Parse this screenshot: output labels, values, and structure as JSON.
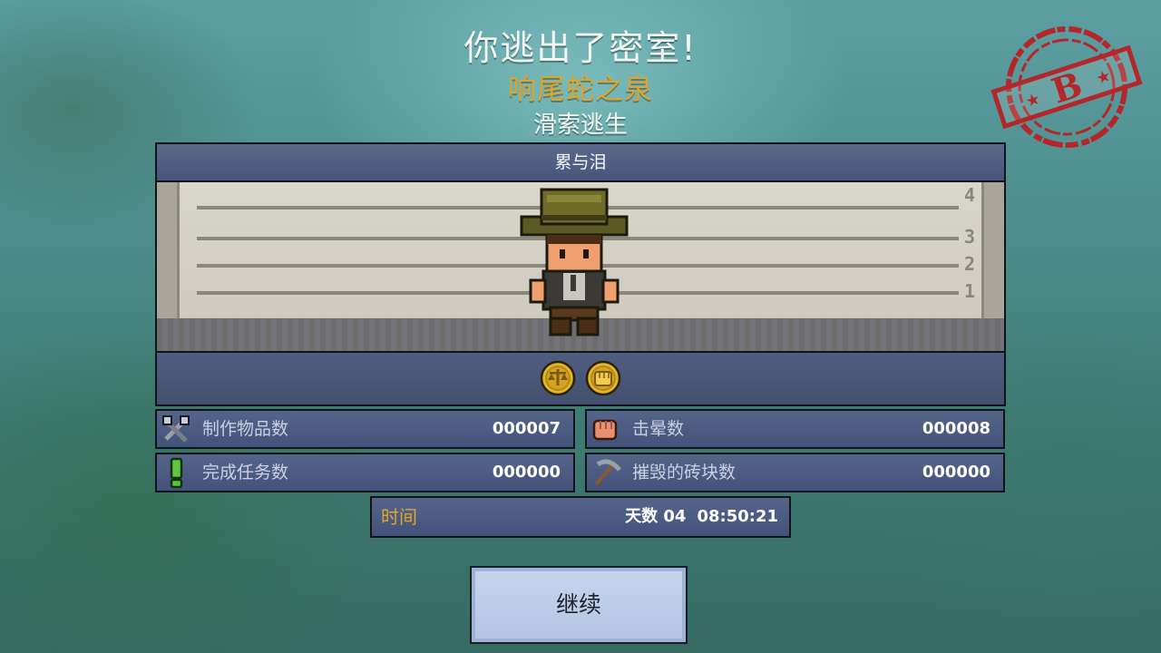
{
  "header": {
    "title": "你逃出了密室!",
    "prison_name": "响尾蛇之泉",
    "escape_method": "滑索逃生"
  },
  "grade_stamp": {
    "grade": "B"
  },
  "lineup": {
    "header": "累与泪",
    "height_marks": [
      "4",
      "3",
      "2",
      "1"
    ],
    "medals": 2
  },
  "stats": [
    {
      "label": "制作物品数",
      "value": "000007",
      "icon": "tools-icon"
    },
    {
      "label": "击晕数",
      "value": "000008",
      "icon": "fist-icon"
    },
    {
      "label": "完成任务数",
      "value": "000000",
      "icon": "exclamation-icon"
    },
    {
      "label": "摧毁的砖块数",
      "value": "000000",
      "icon": "pickaxe-icon"
    }
  ],
  "time": {
    "label": "时间",
    "days_label": "天数 04",
    "clock": "08:50:21"
  },
  "continue_button": {
    "label": "继续"
  },
  "colors": {
    "accent_orange": "#e0a42a",
    "panel_blue": "#4a5878",
    "stamp_red": "#b3262a",
    "button_blue": "#b9cbe8"
  }
}
